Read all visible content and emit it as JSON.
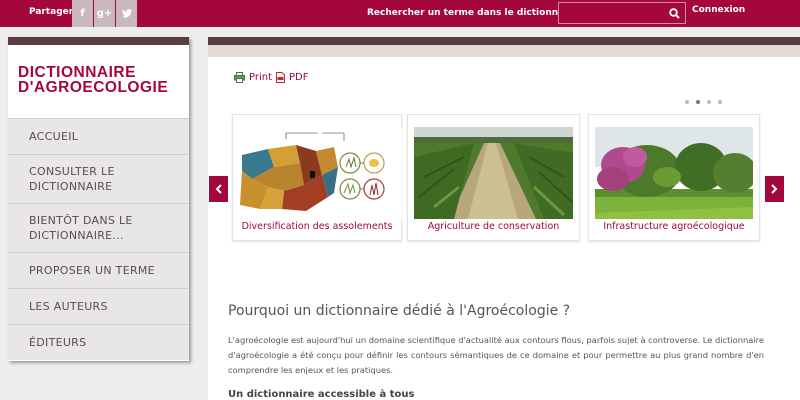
{
  "topbar": {
    "share_label": "Partager",
    "social": [
      {
        "icon": "facebook-icon",
        "glyph": "f"
      },
      {
        "icon": "google-plus-icon",
        "glyph": "g+"
      },
      {
        "icon": "twitter-icon",
        "glyph": "t"
      }
    ],
    "search_label": "Rechercher un terme dans le dictionnaire :",
    "search_value": "",
    "search_icon": "search-icon",
    "login_label": "Connexion"
  },
  "sidebar": {
    "logo_line1": "DICTIONNAIRE",
    "logo_line2": "D'AGROECOLOGIE",
    "menu": [
      {
        "label": "ACCUEIL"
      },
      {
        "label": "CONSULTER LE DICTIONNAIRE"
      },
      {
        "label": "BIENTÔT DANS LE DICTIONNAIRE..."
      },
      {
        "label": "PROPOSER UN TERME"
      },
      {
        "label": "LES AUTEURS"
      },
      {
        "label": "ÉDITEURS"
      }
    ]
  },
  "main": {
    "print_label": "Print",
    "pdf_label": "PDF",
    "carousel": {
      "active_dot": 2,
      "dot_count": 4,
      "cards": [
        {
          "caption": "Diversification des assolements"
        },
        {
          "caption": "Agriculture de conservation"
        },
        {
          "caption": "Infrastructure agroécologique"
        }
      ]
    },
    "heading": "Pourquoi un dictionnaire dédié à l'Agroécologie ?",
    "paragraph": "L'agroécologie est aujourd'hui un domaine scientifique d'actualité aux contours flous, parfois sujet à controverse. Le dictionnaire d'agroécologie a été conçu pour définir les contours sémantiques de ce domaine et pour  permettre au plus grand nombre d'en comprendre les enjeux et les pratiques.",
    "subheading": "Un dictionnaire accessible à tous"
  },
  "colors": {
    "brand": "#a4073c",
    "dark_band": "#5a3d43",
    "social_bg": "#c9b9bd"
  }
}
